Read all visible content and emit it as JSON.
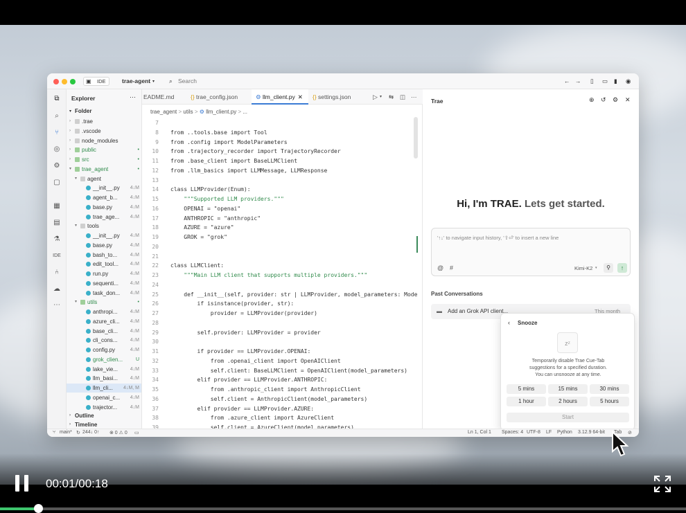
{
  "app": {
    "mode": "IDE",
    "project": "trae-agent",
    "search_placeholder": "Search"
  },
  "explorer": {
    "title": "Explorer",
    "folder": "Folder",
    "outline": "Outline",
    "timeline": "Timeline",
    "rows": [
      {
        "name": ".trae",
        "depth": 0,
        "type": "folder",
        "open": false,
        "status": ""
      },
      {
        "name": ".vscode",
        "depth": 0,
        "type": "folder",
        "open": false,
        "status": ""
      },
      {
        "name": "node_modules",
        "depth": 0,
        "type": "folder",
        "open": false,
        "status": ""
      },
      {
        "name": "public",
        "depth": 0,
        "type": "folder",
        "open": false,
        "status": "•"
      },
      {
        "name": "src",
        "depth": 0,
        "type": "folder",
        "open": false,
        "status": "•"
      },
      {
        "name": "trae_agent",
        "depth": 0,
        "type": "folder",
        "open": true,
        "status": "•"
      },
      {
        "name": "agent",
        "depth": 1,
        "type": "folder",
        "open": true,
        "status": ""
      },
      {
        "name": "__init__.py",
        "depth": 2,
        "type": "file",
        "status": "4↓M"
      },
      {
        "name": "agent_b...",
        "depth": 2,
        "type": "file",
        "status": "4↓M"
      },
      {
        "name": "base.py",
        "depth": 2,
        "type": "file",
        "status": "4↓M"
      },
      {
        "name": "trae_age...",
        "depth": 2,
        "type": "file",
        "status": "4↓M"
      },
      {
        "name": "tools",
        "depth": 1,
        "type": "folder",
        "open": true,
        "status": ""
      },
      {
        "name": "__init__.py",
        "depth": 2,
        "type": "file",
        "status": "4↓M"
      },
      {
        "name": "base.py",
        "depth": 2,
        "type": "file",
        "status": "4↓M"
      },
      {
        "name": "bash_to...",
        "depth": 2,
        "type": "file",
        "status": "4↓M"
      },
      {
        "name": "edit_tool...",
        "depth": 2,
        "type": "file",
        "status": "4↓M"
      },
      {
        "name": "run.py",
        "depth": 2,
        "type": "file",
        "status": "4↓M"
      },
      {
        "name": "sequenti...",
        "depth": 2,
        "type": "file",
        "status": "4↓M"
      },
      {
        "name": "task_don...",
        "depth": 2,
        "type": "file",
        "status": "4↓M"
      },
      {
        "name": "utils",
        "depth": 1,
        "type": "folder",
        "open": true,
        "status": "•"
      },
      {
        "name": "anthropi...",
        "depth": 2,
        "type": "file",
        "status": "4↓M"
      },
      {
        "name": "azure_cli...",
        "depth": 2,
        "type": "file",
        "status": "4↓M"
      },
      {
        "name": "base_cli...",
        "depth": 2,
        "type": "file",
        "status": "4↓M"
      },
      {
        "name": "cli_cons...",
        "depth": 2,
        "type": "file",
        "status": "4↓M"
      },
      {
        "name": "config.py",
        "depth": 2,
        "type": "file",
        "status": "4↓M"
      },
      {
        "name": "grok_clien...",
        "depth": 2,
        "type": "file",
        "status": "U"
      },
      {
        "name": "lake_vie...",
        "depth": 2,
        "type": "file",
        "status": "4↓M"
      },
      {
        "name": "llm_basi...",
        "depth": 2,
        "type": "file",
        "status": "4↓M"
      },
      {
        "name": "llm_cli...",
        "depth": 2,
        "type": "file",
        "status": "4↓M, M"
      },
      {
        "name": "openai_c...",
        "depth": 2,
        "type": "file",
        "status": "4↓M"
      },
      {
        "name": "trajector...",
        "depth": 2,
        "type": "file",
        "status": "4↓M"
      }
    ]
  },
  "tabs": [
    "EADME.md",
    "trae_config.json",
    "llm_client.py",
    "settings.json"
  ],
  "breadcrumb": [
    "trae_agent",
    ">",
    "utils",
    ">",
    "llm_client.py",
    ">",
    "..."
  ],
  "code": [
    {
      "n": "7",
      "t": ""
    },
    {
      "n": "8",
      "t": "from ..tools.base import Tool"
    },
    {
      "n": "9",
      "t": "from .config import ModelParameters"
    },
    {
      "n": "10",
      "t": "from .trajectory_recorder import TrajectoryRecorder"
    },
    {
      "n": "11",
      "t": "from .base_client import BaseLLMClient"
    },
    {
      "n": "12",
      "t": "from .llm_basics import LLMMessage, LLMResponse"
    },
    {
      "n": "13",
      "t": ""
    },
    {
      "n": "14",
      "t": "class LLMProvider(Enum):"
    },
    {
      "n": "15",
      "t": "    \"\"\"Supported LLM providers.\"\"\""
    },
    {
      "n": "16",
      "t": "    OPENAI = \"openai\""
    },
    {
      "n": "17",
      "t": "    ANTHROPIC = \"anthropic\""
    },
    {
      "n": "18",
      "t": "    AZURE = \"azure\""
    },
    {
      "n": "19",
      "t": "    GROK = \"grok\""
    },
    {
      "n": "20",
      "t": ""
    },
    {
      "n": "21",
      "t": ""
    },
    {
      "n": "22",
      "t": "class LLMClient:"
    },
    {
      "n": "23",
      "t": "    \"\"\"Main LLM client that supports multiple providers.\"\"\""
    },
    {
      "n": "24",
      "t": ""
    },
    {
      "n": "25",
      "t": "    def __init__(self, provider: str | LLMProvider, model_parameters: Mode"
    },
    {
      "n": "26",
      "t": "        if isinstance(provider, str):"
    },
    {
      "n": "27",
      "t": "            provider = LLMProvider(provider)"
    },
    {
      "n": "28",
      "t": ""
    },
    {
      "n": "29",
      "t": "        self.provider: LLMProvider = provider"
    },
    {
      "n": "30",
      "t": ""
    },
    {
      "n": "31",
      "t": "        if provider == LLMProvider.OPENAI:"
    },
    {
      "n": "32",
      "t": "            from .openai_client import OpenAIClient"
    },
    {
      "n": "33",
      "t": "            self.client: BaseLLMClient = OpenAIClient(model_parameters)"
    },
    {
      "n": "34",
      "t": "        elif provider == LLMProvider.ANTHROPIC:"
    },
    {
      "n": "35",
      "t": "            from .anthropic_client import AnthropicClient"
    },
    {
      "n": "36",
      "t": "            self.client = AnthropicClient(model_parameters)"
    },
    {
      "n": "37",
      "t": "        elif provider == LLMProvider.AZURE:"
    },
    {
      "n": "38",
      "t": "            from .azure_client import AzureClient"
    },
    {
      "n": "39",
      "t": "            self.client = AzureClient(model_parameters)"
    }
  ],
  "chat": {
    "title": "Trae",
    "greeting_a": "Hi, I'm TRAE.",
    "greeting_b": "Lets get started.",
    "input_placeholder": "'↑↓' to navigate input history, '⇧⏎' to insert a new line",
    "model": "Kimi-K2",
    "past_title": "Past Conversations",
    "past_item": "Add an Grok API client...",
    "past_time": "This month"
  },
  "snooze": {
    "title": "Snooze",
    "desc1": "Temporarily disable Trae Cue-Tab",
    "desc2": "suggestions for a specified duration.",
    "desc3": "You can unsnooze at any time.",
    "options": [
      "5 mins",
      "15 mins",
      "30 mins",
      "1 hour",
      "2 hours",
      "5 hours"
    ],
    "start": "Start"
  },
  "status": {
    "branch": "main*",
    "sync": "244↓ 0↑",
    "problems": "⊗ 0 ⚠ 0",
    "position": "Ln 1, Col 1",
    "spaces": "Spaces: 4",
    "encoding": "UTF-8",
    "eol": "LF",
    "language": "Python",
    "version": "3.12.9 64-bit",
    "tab": "Tab"
  },
  "video": {
    "time": "00:01/00:18",
    "progress": 0.056
  }
}
